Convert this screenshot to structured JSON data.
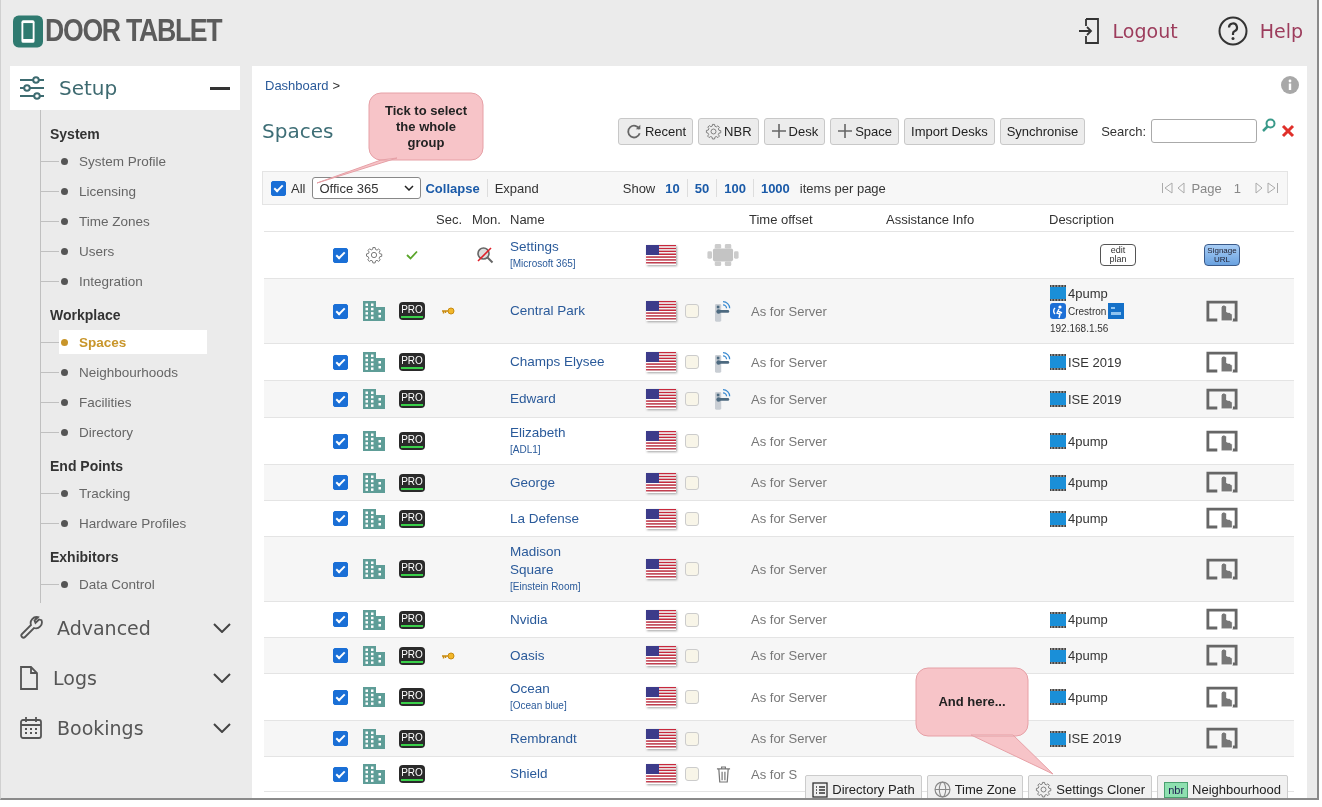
{
  "header": {
    "logo": "DOOR TABLET",
    "links": [
      {
        "kind": "logout",
        "label": "Logout"
      },
      {
        "kind": "help",
        "label": "Help"
      }
    ]
  },
  "sidebar": {
    "setup": {
      "label": "Setup",
      "expanded": true
    },
    "groups": [
      {
        "title": "System",
        "items": [
          {
            "label": "System Profile",
            "selected": false
          },
          {
            "label": "Licensing",
            "selected": false
          },
          {
            "label": "Time Zones",
            "selected": false
          },
          {
            "label": "Users",
            "selected": false
          },
          {
            "label": "Integration",
            "selected": false
          }
        ]
      },
      {
        "title": "Workplace",
        "items": [
          {
            "label": "Spaces",
            "selected": true
          },
          {
            "label": "Neighbourhoods",
            "selected": false
          },
          {
            "label": "Facilities",
            "selected": false
          },
          {
            "label": "Directory",
            "selected": false
          }
        ]
      },
      {
        "title": "End Points",
        "items": [
          {
            "label": "Tracking",
            "selected": false
          },
          {
            "label": "Hardware Profiles",
            "selected": false
          }
        ]
      },
      {
        "title": "Exhibitors",
        "items": [
          {
            "label": "Data Control",
            "selected": false
          }
        ]
      }
    ],
    "sections": [
      {
        "kind": "wrench",
        "label": "Advanced",
        "expanded": false
      },
      {
        "kind": "file",
        "label": "Logs",
        "expanded": false
      },
      {
        "kind": "calendar",
        "label": "Bookings",
        "expanded": false
      }
    ]
  },
  "breadcrumb": {
    "link": "Dashboard",
    "separator": ">"
  },
  "title": "Spaces",
  "toolbar": [
    {
      "kind": "refresh",
      "label": "Recent"
    },
    {
      "kind": "gear",
      "label": "NBR"
    },
    {
      "kind": "plus",
      "label": "Desk"
    },
    {
      "kind": "plus",
      "label": "Space"
    },
    {
      "kind": "text",
      "label": "Import Desks"
    },
    {
      "kind": "text",
      "label": "Synchronise"
    }
  ],
  "search": {
    "label": "Search:"
  },
  "filter": {
    "all_label": "All",
    "all_checked": true,
    "group": "Office 365",
    "collapse": "Collapse",
    "expand": "Expand",
    "show": "Show",
    "page_sizes": [
      "10",
      "50",
      "100",
      "1000"
    ],
    "items_per_page": "items per page",
    "page_label": "Page",
    "page": "1"
  },
  "table": {
    "columns": [
      "Sec.",
      "Mon.",
      "Name",
      "Time offset",
      "Assistance Info",
      "Description"
    ],
    "rows": [
      {
        "kind": "settings",
        "checked": true,
        "name": "Settings",
        "alias": "[Microsoft 365]",
        "edit_label": "edit plan",
        "signage_label": "Signage URL"
      },
      {
        "kind": "space",
        "checked": true,
        "badge": "PRO",
        "key": true,
        "name": "Central Park",
        "flag_checked": false,
        "door": true,
        "time": "As for Server",
        "description": [
          {
            "kind": "video",
            "text": "4pump"
          },
          {
            "kind": "crestron",
            "text": "Crestron"
          },
          {
            "kind": "ip",
            "text": "192.168.1.56"
          }
        ],
        "touch_icon": true,
        "trash": false
      },
      {
        "kind": "space",
        "checked": true,
        "badge": "PRO",
        "key": false,
        "name": "Champs Elysee",
        "flag_checked": false,
        "door": true,
        "time": "As for Server",
        "description": [
          {
            "kind": "video",
            "text": "ISE 2019"
          }
        ],
        "touch_icon": true,
        "trash": false
      },
      {
        "kind": "space",
        "checked": true,
        "badge": "PRO",
        "key": false,
        "name": "Edward",
        "flag_checked": false,
        "door": true,
        "time": "As for Server",
        "description": [
          {
            "kind": "video",
            "text": "ISE 2019"
          }
        ],
        "touch_icon": true,
        "trash": false
      },
      {
        "kind": "space",
        "checked": true,
        "badge": "PRO",
        "key": false,
        "name": "Elizabeth",
        "alias": "[ADL1]",
        "flag_checked": false,
        "door": false,
        "time": "As for Server",
        "description": [
          {
            "kind": "video",
            "text": "4pump"
          }
        ],
        "touch_icon": true,
        "trash": false
      },
      {
        "kind": "space",
        "checked": true,
        "badge": "PRO",
        "key": false,
        "name": "George",
        "flag_checked": false,
        "door": false,
        "time": "As for Server",
        "description": [
          {
            "kind": "video",
            "text": "4pump"
          }
        ],
        "touch_icon": true,
        "trash": false
      },
      {
        "kind": "space",
        "checked": true,
        "badge": "PRO",
        "key": false,
        "name": "La Defense",
        "flag_checked": false,
        "door": false,
        "time": "As for Server",
        "description": [
          {
            "kind": "video",
            "text": "4pump"
          }
        ],
        "touch_icon": true,
        "trash": false
      },
      {
        "kind": "space",
        "checked": true,
        "badge": "PRO",
        "key": false,
        "name": "Madison Square",
        "alias": "[Einstein Room]",
        "flag_checked": false,
        "door": false,
        "time": "As for Server",
        "touch_icon": true,
        "trash": false
      },
      {
        "kind": "space",
        "checked": true,
        "badge": "PRO",
        "key": false,
        "name": "Nvidia",
        "flag_checked": false,
        "door": false,
        "time": "As for Server",
        "description": [
          {
            "kind": "video",
            "text": "4pump"
          }
        ],
        "touch_icon": true,
        "trash": false
      },
      {
        "kind": "space",
        "checked": true,
        "badge": "PRO",
        "key": true,
        "name": "Oasis",
        "flag_checked": false,
        "door": false,
        "time": "As for Server",
        "description": [
          {
            "kind": "video",
            "text": "4pump"
          }
        ],
        "touch_icon": true,
        "trash": false
      },
      {
        "kind": "space",
        "checked": true,
        "badge": "PRO",
        "key": false,
        "name": "Ocean",
        "alias": "[Ocean blue]",
        "flag_checked": false,
        "door": false,
        "time": "As for Server",
        "description": [
          {
            "kind": "video",
            "text": "4pump"
          }
        ],
        "touch_icon": true,
        "trash": false
      },
      {
        "kind": "space",
        "checked": true,
        "badge": "PRO",
        "key": false,
        "name": "Rembrandt",
        "flag_checked": false,
        "door": false,
        "time": "As for Server",
        "description": [
          {
            "kind": "video",
            "text": "ISE 2019"
          }
        ],
        "touch_icon": true,
        "trash": false
      },
      {
        "kind": "space",
        "checked": true,
        "badge": "PRO",
        "key": false,
        "name": "Shield",
        "flag_checked": false,
        "door": false,
        "time": "As for S",
        "touch_icon": false,
        "trash": true
      }
    ]
  },
  "bottom_toolbar": [
    {
      "kind": "list",
      "label": "Directory Path"
    },
    {
      "kind": "globe",
      "label": "Time Zone"
    },
    {
      "kind": "gear",
      "label": "Settings Cloner"
    },
    {
      "kind": "nbr",
      "badge": "nbr",
      "label": "Neighbourhood"
    }
  ],
  "callouts": [
    {
      "kind": "top",
      "text": "Tick to select the whole group"
    },
    {
      "kind": "bottom",
      "text": "And here..."
    }
  ]
}
